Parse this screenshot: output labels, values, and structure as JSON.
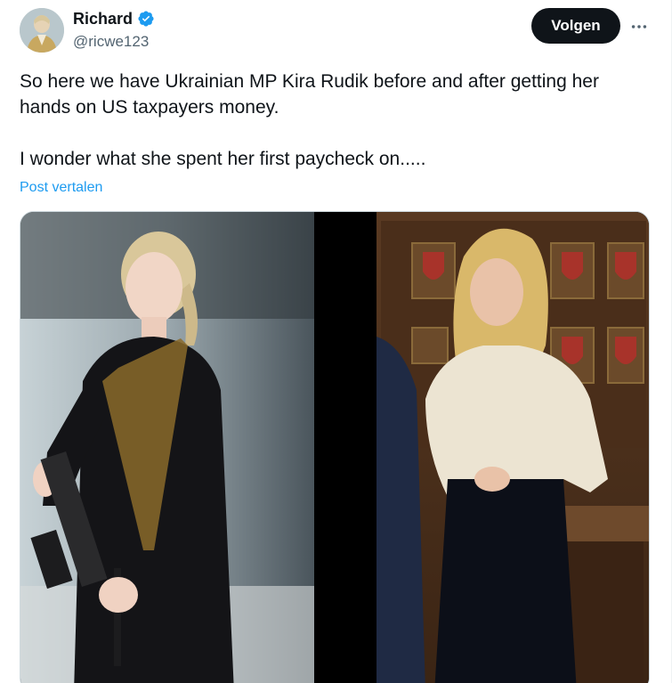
{
  "author": {
    "display_name": "Richard",
    "handle": "@ricwe123",
    "avatar_icon": "user-avatar",
    "verified_icon": "verified-badge-icon",
    "verified_color": "#1d9bf0"
  },
  "actions": {
    "follow_label": "Volgen",
    "more_icon": "more-horizontal-icon"
  },
  "tweet": {
    "text": "So here we have Ukrainian MP Kira Rudik before and after getting her hands on US taxpayers money.\n\nI wonder what she spent her first paycheck on.....",
    "translate_label": "Post vertalen"
  },
  "media": {
    "type": "photo-collage",
    "panels": [
      "left-photo-woman-black-outfit",
      "right-photo-woman-cream-sweater"
    ]
  },
  "colors": {
    "accent": "#1d9bf0",
    "text_primary": "#0f1419",
    "text_secondary": "#536471",
    "follow_bg": "#0f1419"
  }
}
